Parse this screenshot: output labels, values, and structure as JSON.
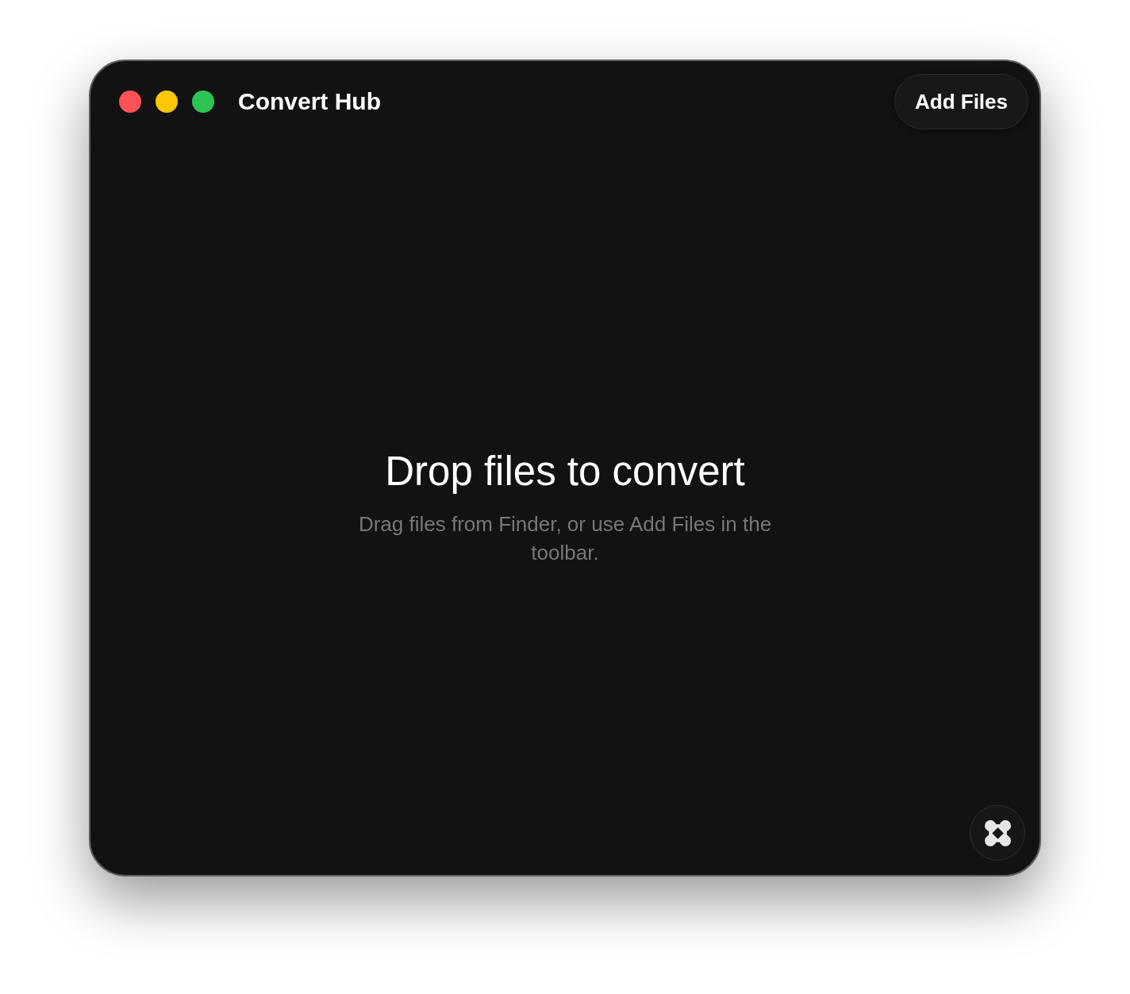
{
  "window": {
    "title": "Convert Hub"
  },
  "traffic_lights": [
    {
      "color": "#fd5257"
    },
    {
      "color": "#fbc707"
    },
    {
      "color": "#2ec453"
    }
  ],
  "toolbar": {
    "add_files_button": "Add Files"
  },
  "empty_state": {
    "title": "Drop files to convert",
    "subtitle": "Drag files from Finder, or use Add Files in the toolbar."
  }
}
